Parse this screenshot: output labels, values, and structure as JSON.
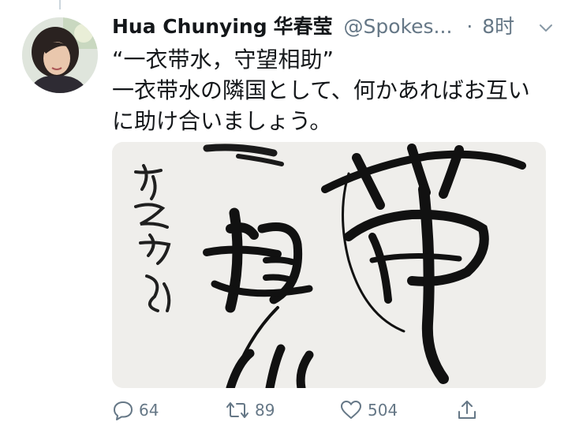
{
  "tweet": {
    "author": {
      "display_name": "Hua Chunying",
      "display_name_cjk": "华春莹",
      "handle": "@Spokes...",
      "avatar": "profile-photo"
    },
    "separator": "·",
    "timestamp": "8时",
    "menu_icon": "chevron-down-icon",
    "text_lines": [
      "“一衣带水，守望相助”",
      "一衣带水の隣国として、何かあればお互い",
      "に助け合いましょう。"
    ],
    "media": {
      "type": "calligraphy-photo"
    },
    "actions": {
      "reply": {
        "icon": "reply-icon",
        "count": "64"
      },
      "retweet": {
        "icon": "retweet-icon",
        "count": "89"
      },
      "like": {
        "icon": "heart-icon",
        "count": "504"
      },
      "share": {
        "icon": "share-icon"
      }
    }
  },
  "colors": {
    "text_primary": "#14171a",
    "text_secondary": "#657786",
    "thread_line": "#ccd6dd",
    "paper": "#efefed",
    "ink": "#1a1a1a"
  }
}
